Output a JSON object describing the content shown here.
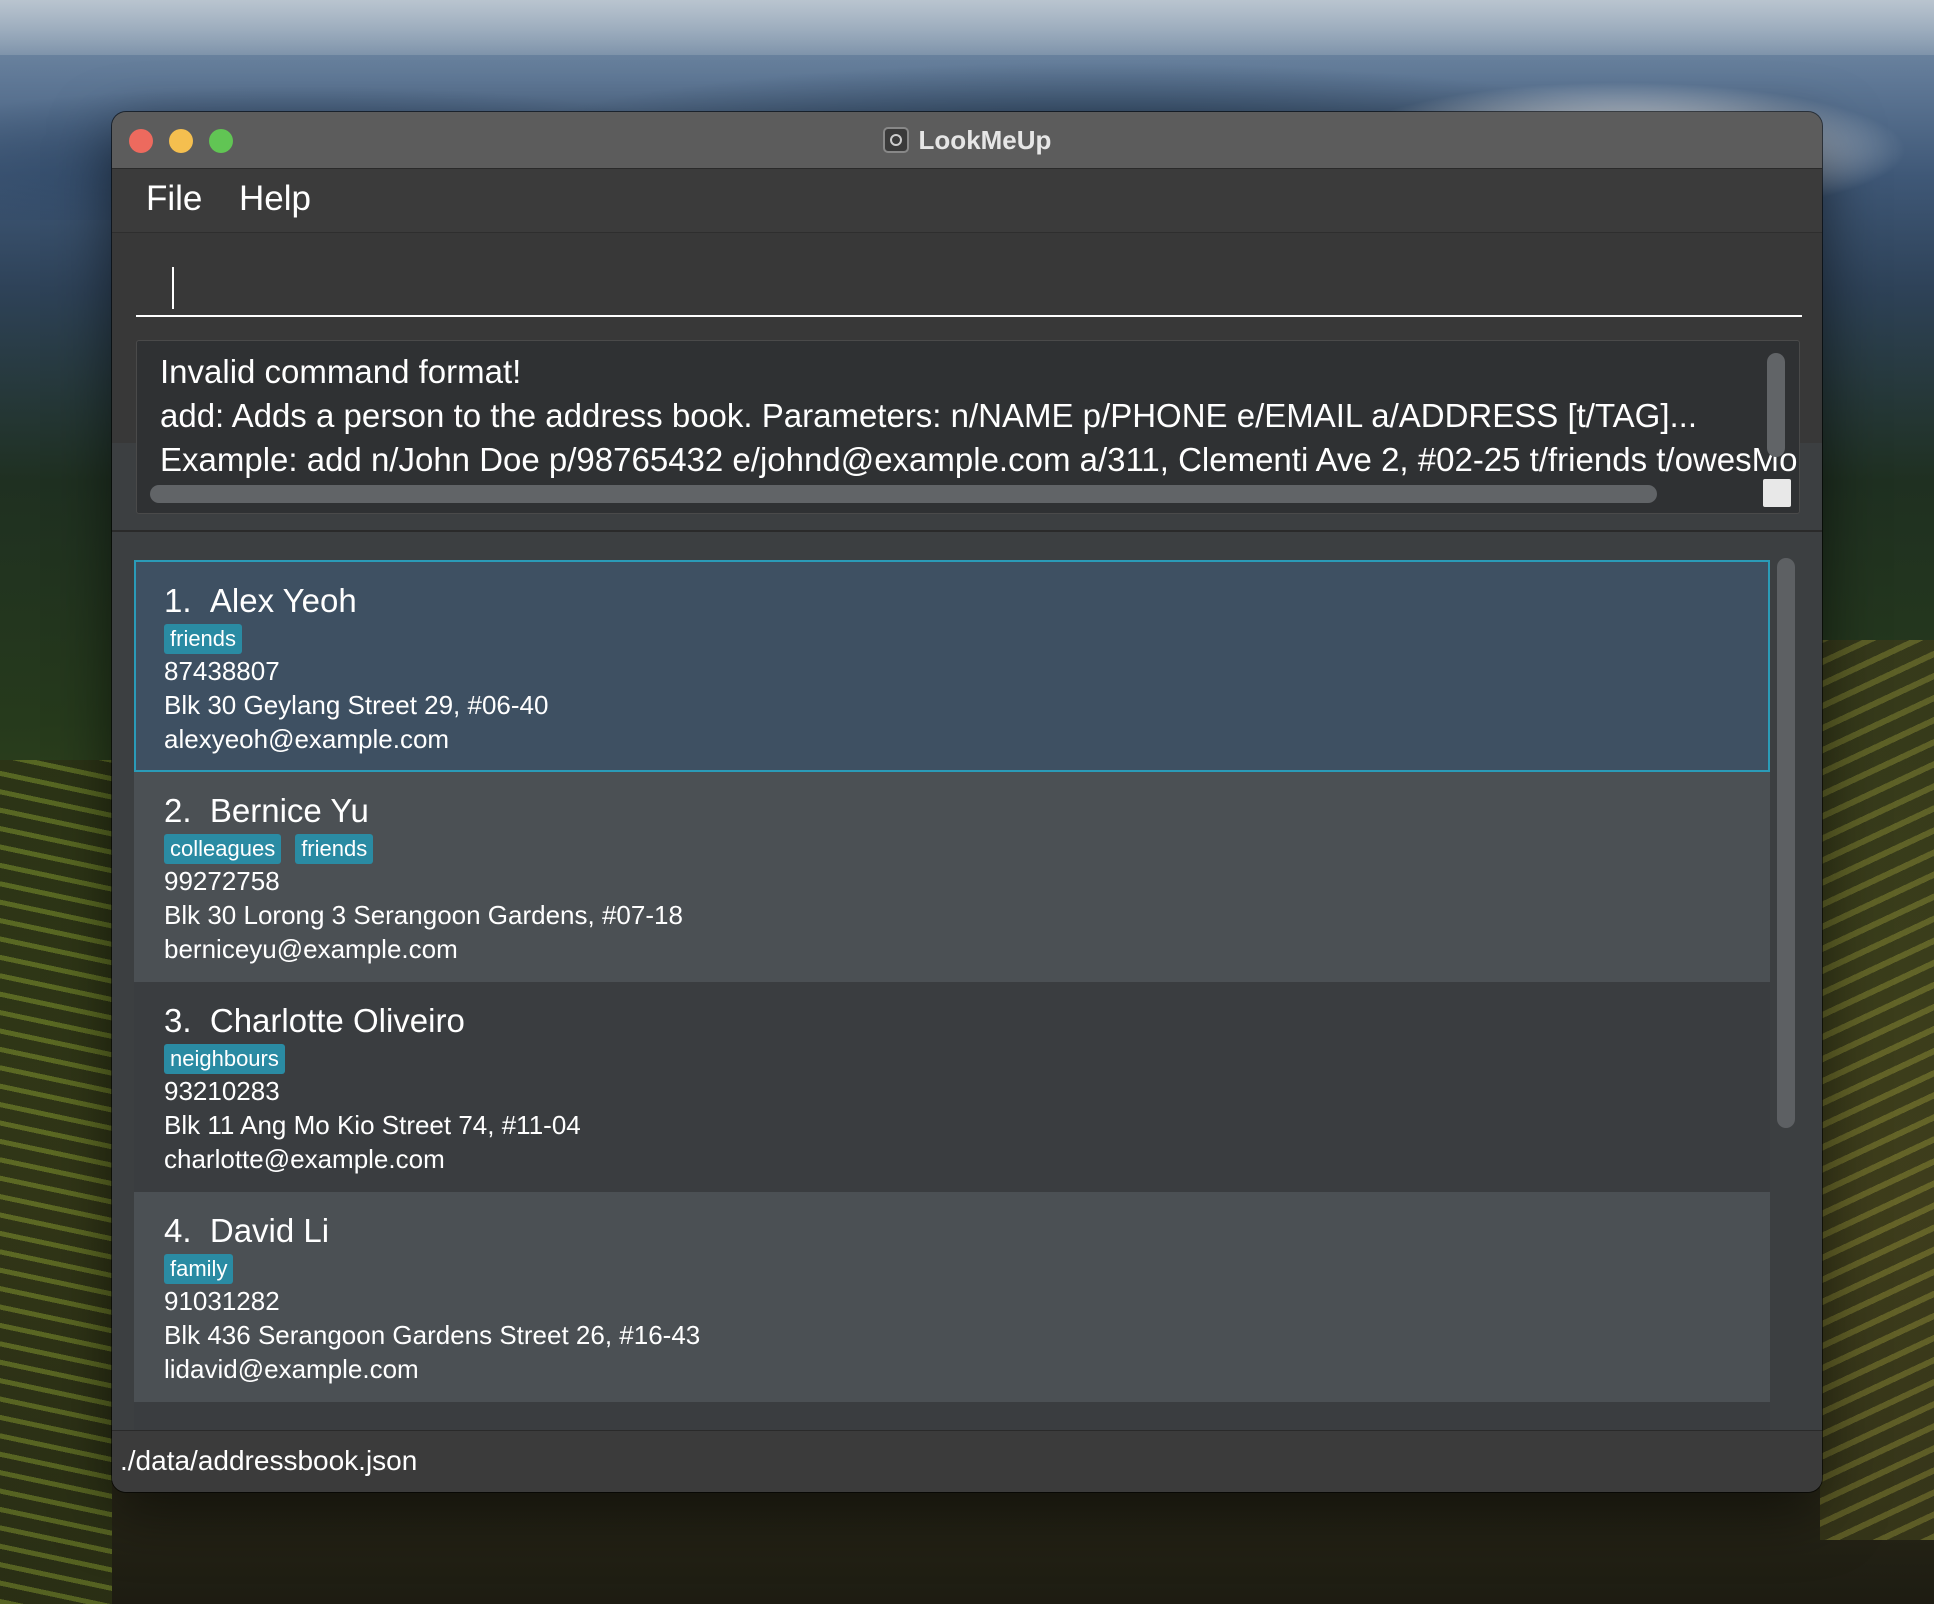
{
  "window": {
    "title": "LookMeUp",
    "app_icon": "lookmeup-app-icon"
  },
  "menu": {
    "file": "File",
    "help": "Help"
  },
  "command": {
    "value": ""
  },
  "result": {
    "lines": [
      "Invalid command format!",
      "add: Adds a person to the address book. Parameters: n/NAME p/PHONE e/EMAIL a/ADDRESS [t/TAG]...",
      "Example: add n/John Doe p/98765432 e/johnd@example.com a/311, Clementi Ave 2, #02-25 t/friends t/owesMoney"
    ]
  },
  "persons": [
    {
      "index": "1.",
      "name": "Alex Yeoh",
      "tags": [
        "friends"
      ],
      "phone": "87438807",
      "address": "Blk 30 Geylang Street 29, #06-40",
      "email": "alexyeoh@example.com"
    },
    {
      "index": "2.",
      "name": "Bernice Yu",
      "tags": [
        "colleagues",
        "friends"
      ],
      "phone": "99272758",
      "address": "Blk 30 Lorong 3 Serangoon Gardens, #07-18",
      "email": "berniceyu@example.com"
    },
    {
      "index": "3.",
      "name": "Charlotte Oliveiro",
      "tags": [
        "neighbours"
      ],
      "phone": "93210283",
      "address": "Blk 11 Ang Mo Kio Street 74, #11-04",
      "email": "charlotte@example.com"
    },
    {
      "index": "4.",
      "name": "David Li",
      "tags": [
        "family"
      ],
      "phone": "91031282",
      "address": "Blk 436 Serangoon Gardens Street 26, #16-43",
      "email": "lidavid@example.com"
    }
  ],
  "status": {
    "file_path": "./data/addressbook.json"
  },
  "colors": {
    "tag_bg": "#2a8ba3",
    "selected_border": "#2a9bb8",
    "selected_bg": "#3e5062"
  }
}
